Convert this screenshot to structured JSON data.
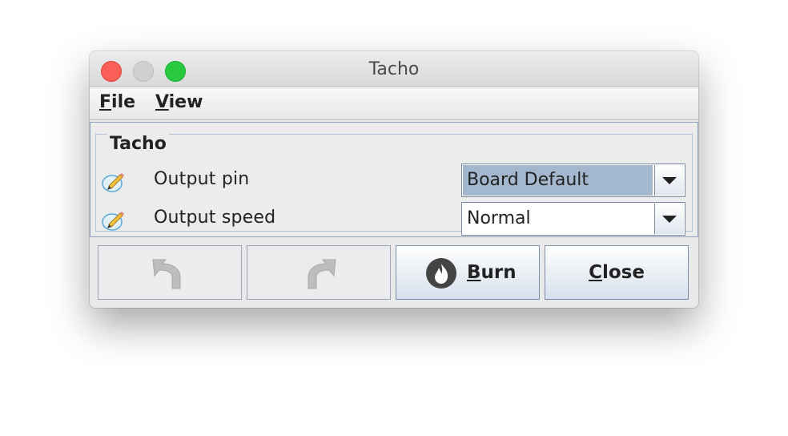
{
  "window": {
    "title": "Tacho"
  },
  "menu": {
    "file": "File",
    "view": "View"
  },
  "group": {
    "title": "Tacho",
    "rows": [
      {
        "label": "Output pin",
        "value": "Board Default",
        "selected": true
      },
      {
        "label": "Output speed",
        "value": "Normal",
        "selected": false
      }
    ]
  },
  "buttons": {
    "undo_icon": "undo-icon",
    "redo_icon": "redo-icon",
    "burn": "Burn",
    "burn_icon": "flame-icon",
    "close": "Close"
  },
  "colors": {
    "combo_selected": "#a3b8cf",
    "close_light": "#fc5f57",
    "max_light": "#29c940"
  }
}
